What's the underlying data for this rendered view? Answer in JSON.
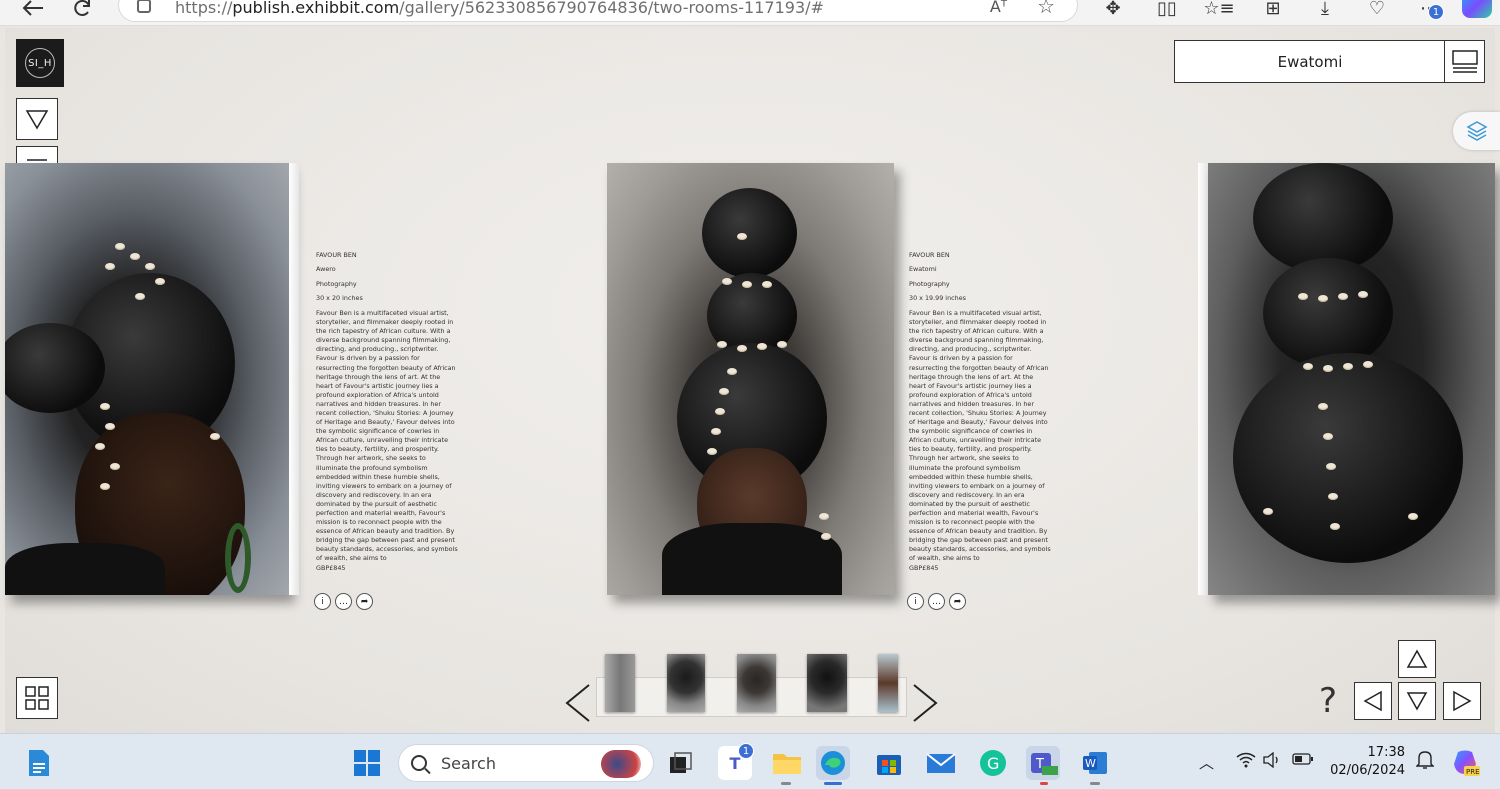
{
  "browser": {
    "url_prefix": "https://",
    "url_domain": "publish.exhibbit.com",
    "url_path": "/gallery/562330856790764836/two-rooms-117193/#",
    "reader_label": "Aᵀ"
  },
  "gallery": {
    "logo_text": "SI_H",
    "current_title": "Ewatomi"
  },
  "artworks": [
    {
      "artist": "FAVOUR BEN",
      "title": "Awero",
      "medium": "Photography",
      "size": "30 x 20 inches",
      "bio": "Favour Ben is a multifaceted visual artist, storyteller, and filmmaker deeply rooted in the rich tapestry of African culture. With a diverse background spanning filmmaking, directing, and producing., scriptwriter. Favour is driven by a passion for resurrecting the forgotten beauty of African heritage through the lens of art. At the heart of Favour's artistic journey lies a profound exploration of Africa's untold narratives and hidden treasures. In her recent collection, 'Shuku Stories: A Journey of Heritage and Beauty,' Favour delves into the symbolic significance of cowries in African culture, unravelling their intricate ties to beauty, fertility, and prosperity. Through her artwork, she seeks to illuminate the profound symbolism embedded within these humble shells, inviting viewers to embark on a journey of discovery and rediscovery. In an era dominated by the pursuit of aesthetic perfection and material wealth, Favour's mission is to reconnect people with the essence of African beauty and tradition. By bridging the gap between past and present beauty standards, accessories, and symbols of wealth, she aims to",
      "price": "GBP£845"
    },
    {
      "artist": "FAVOUR BEN",
      "title": "Ewatomi",
      "medium": "Photography",
      "size": "30 x 19.99 inches",
      "bio": "Favour Ben is a multifaceted visual artist, storyteller, and filmmaker deeply rooted in the rich tapestry of African culture. With a diverse background spanning filmmaking, directing, and producing., scriptwriter. Favour is driven by a passion for resurrecting the forgotten beauty of African heritage through the lens of art. At the heart of Favour's artistic journey lies a profound exploration of Africa's untold narratives and hidden treasures. In her recent collection, 'Shuku Stories: A Journey of Heritage and Beauty,' Favour delves into the symbolic significance of cowries in African culture, unravelling their intricate ties to beauty, fertility, and prosperity. Through her artwork, she seeks to illuminate the profound symbolism embedded within these humble shells, inviting viewers to embark on a journey of discovery and rediscovery. In an era dominated by the pursuit of aesthetic perfection and material wealth, Favour's mission is to reconnect people with the essence of African beauty and tradition. By bridging the gap between past and present beauty standards, accessories, and symbols of wealth, she aims to",
      "price": "GBP£845"
    }
  ],
  "caption_actions": {
    "info": "i",
    "comment": "…",
    "share": "➦"
  },
  "controls": {
    "help": "?"
  },
  "taskbar": {
    "search_label": "Search",
    "teams_badge": "1",
    "time": "17:38",
    "date": "02/06/2024",
    "downloads_badge": "1"
  },
  "colors": {
    "wall": "#e9e6e2",
    "frame": "#ffffff",
    "taskbar": "#dfe7f1",
    "accent_blue": "#3b6fd4"
  }
}
